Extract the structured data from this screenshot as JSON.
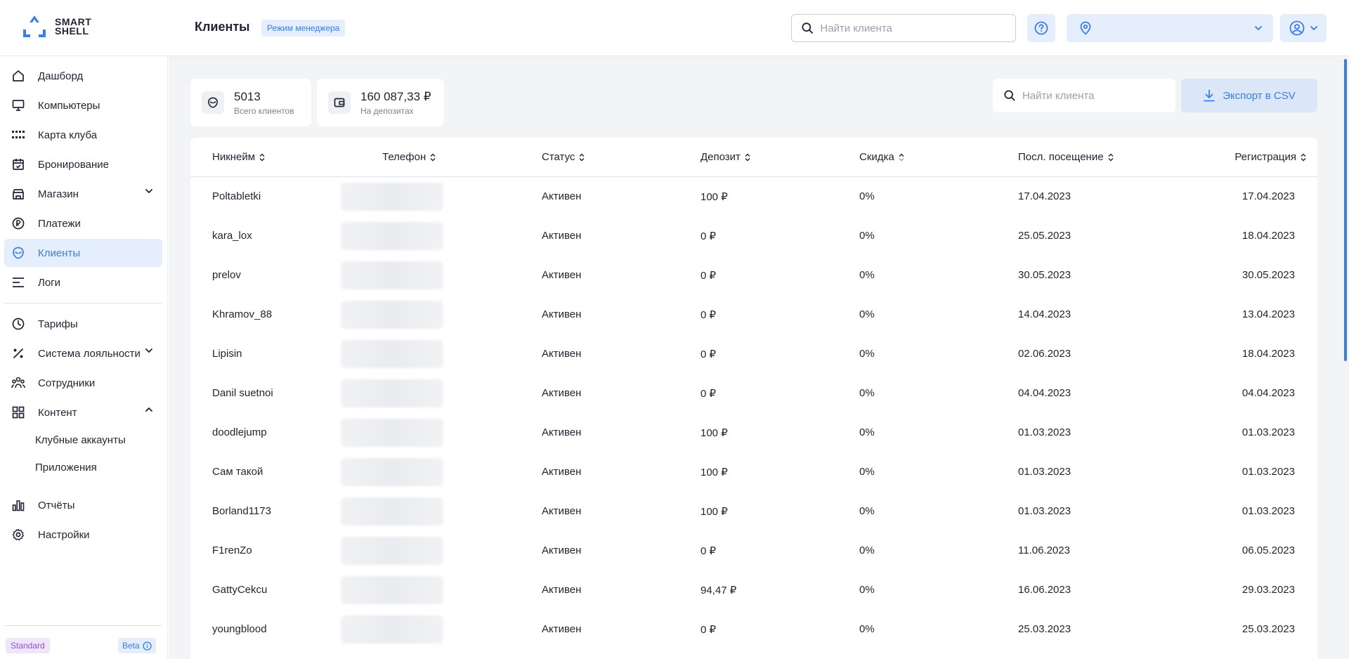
{
  "header": {
    "logo_line1": "SMART",
    "logo_line2": "SHELL",
    "title": "Клиенты",
    "mode_badge": "Режим менеджера",
    "search_placeholder": "Найти клиента",
    "location_value": ""
  },
  "sidebar": {
    "items": [
      {
        "label": "Дашборд",
        "icon": "home-icon"
      },
      {
        "label": "Компьютеры",
        "icon": "monitor-icon"
      },
      {
        "label": "Карта клуба",
        "icon": "grid-dots-icon"
      },
      {
        "label": "Бронирование",
        "icon": "calendar-check-icon"
      },
      {
        "label": "Магазин",
        "icon": "store-icon"
      },
      {
        "label": "Платежи",
        "icon": "ruble-circle-icon"
      },
      {
        "label": "Клиенты",
        "icon": "alien-head-icon",
        "active": true
      },
      {
        "label": "Логи",
        "icon": "lines-icon"
      },
      {
        "label": "Тарифы",
        "icon": "clock-icon"
      },
      {
        "label": "Система лояльности",
        "icon": "percent-icon"
      },
      {
        "label": "Сотрудники",
        "icon": "team-icon"
      },
      {
        "label": "Контент",
        "icon": "apps-grid-icon"
      },
      {
        "label": "Отчёты",
        "icon": "bar-chart-icon"
      },
      {
        "label": "Настройки",
        "icon": "gear-icon"
      }
    ],
    "sub_items": [
      "Клубные аккаунты",
      "Приложения"
    ],
    "plan_badge": "Standard",
    "beta_badge": "Beta"
  },
  "stats": {
    "clients_value": "5013",
    "clients_label": "Всего клиентов",
    "deposits_value": "160 087,33 ₽",
    "deposits_label": "На депозитах"
  },
  "toolbar": {
    "search_placeholder": "Найти клиента",
    "export_label": "Экспорт в CSV"
  },
  "table": {
    "columns": [
      "Никнейм",
      "Телефон",
      "Статус",
      "Депозит",
      "Скидка",
      "Посл. посещение",
      "Регистрация"
    ],
    "rows": [
      {
        "nick": "Poltabletki",
        "status": "Активен",
        "deposit": "100 ₽",
        "discount": "0%",
        "last": "17.04.2023",
        "reg": "17.04.2023"
      },
      {
        "nick": "kara_lox",
        "status": "Активен",
        "deposit": "0 ₽",
        "discount": "0%",
        "last": "25.05.2023",
        "reg": "18.04.2023"
      },
      {
        "nick": "prelov",
        "status": "Активен",
        "deposit": "0 ₽",
        "discount": "0%",
        "last": "30.05.2023",
        "reg": "30.05.2023"
      },
      {
        "nick": "Khramov_88",
        "status": "Активен",
        "deposit": "0 ₽",
        "discount": "0%",
        "last": "14.04.2023",
        "reg": "13.04.2023"
      },
      {
        "nick": "Lipisin",
        "status": "Активен",
        "deposit": "0 ₽",
        "discount": "0%",
        "last": "02.06.2023",
        "reg": "18.04.2023"
      },
      {
        "nick": "Danil suetnoi",
        "status": "Активен",
        "deposit": "0 ₽",
        "discount": "0%",
        "last": "04.04.2023",
        "reg": "04.04.2023"
      },
      {
        "nick": "doodlejump",
        "status": "Активен",
        "deposit": "100 ₽",
        "discount": "0%",
        "last": "01.03.2023",
        "reg": "01.03.2023"
      },
      {
        "nick": "Сам такой",
        "status": "Активен",
        "deposit": "100 ₽",
        "discount": "0%",
        "last": "01.03.2023",
        "reg": "01.03.2023"
      },
      {
        "nick": "Borland1173",
        "status": "Активен",
        "deposit": "100 ₽",
        "discount": "0%",
        "last": "01.03.2023",
        "reg": "01.03.2023"
      },
      {
        "nick": "F1renZo",
        "status": "Активен",
        "deposit": "0 ₽",
        "discount": "0%",
        "last": "11.06.2023",
        "reg": "06.05.2023"
      },
      {
        "nick": "GattyCekcu",
        "status": "Активен",
        "deposit": "94,47 ₽",
        "discount": "0%",
        "last": "16.06.2023",
        "reg": "29.03.2023"
      },
      {
        "nick": "youngblood",
        "status": "Активен",
        "deposit": "0 ₽",
        "discount": "0%",
        "last": "25.03.2023",
        "reg": "25.03.2023"
      }
    ]
  },
  "colors": {
    "accent": "#3b7ded",
    "accent_bg": "#e4eefc",
    "page_bg": "#f3f4f6"
  }
}
